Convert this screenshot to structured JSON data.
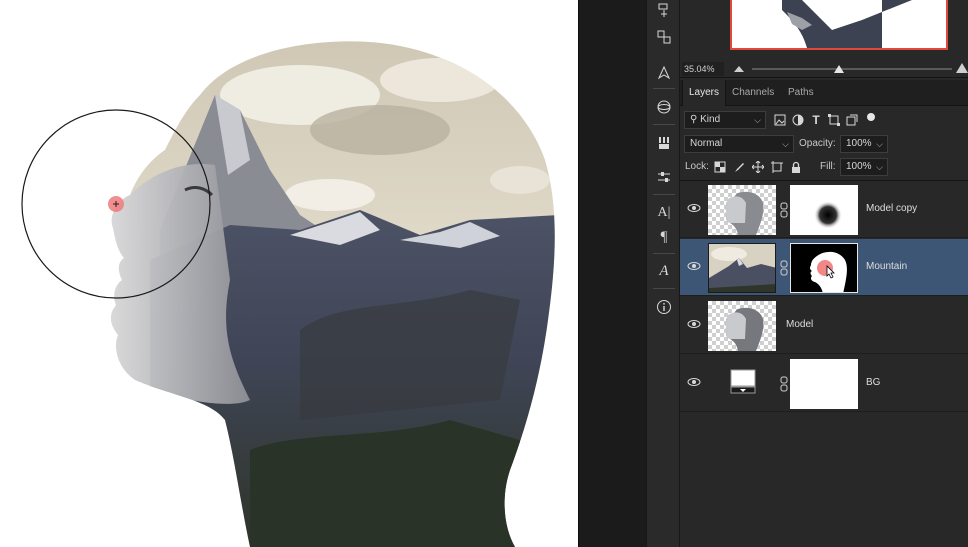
{
  "navigator": {
    "zoom": "35.04%"
  },
  "panel_tabs": [
    {
      "label": "Layers",
      "active": true
    },
    {
      "label": "Channels",
      "active": false
    },
    {
      "label": "Paths",
      "active": false
    }
  ],
  "filter": {
    "kind_label": "Kind"
  },
  "blend": {
    "mode": "Normal",
    "opacity_label": "Opacity:",
    "opacity_value": "100%",
    "lock_label": "Lock:",
    "fill_label": "Fill:",
    "fill_value": "100%"
  },
  "layers": [
    {
      "name": "Model copy",
      "visible": true,
      "selected": false,
      "has_mask": true
    },
    {
      "name": "Mountain",
      "visible": true,
      "selected": true,
      "has_mask": true
    },
    {
      "name": "Model",
      "visible": true,
      "selected": false,
      "has_mask": false
    },
    {
      "name": "BG",
      "visible": true,
      "selected": false,
      "has_mask": true
    }
  ],
  "colors": {
    "selection_highlight": "#3d5675",
    "brush_cursor_accent": "#f07a7a",
    "navigator_frame": "#e0483a"
  },
  "tools": [
    "clone-source-icon",
    "paths-icon",
    "navigator-icon",
    "3d-icon",
    "brush-presets-icon",
    "adjustments-icon",
    "character-icon",
    "paragraph-icon",
    "glyphs-icon",
    "info-icon"
  ]
}
